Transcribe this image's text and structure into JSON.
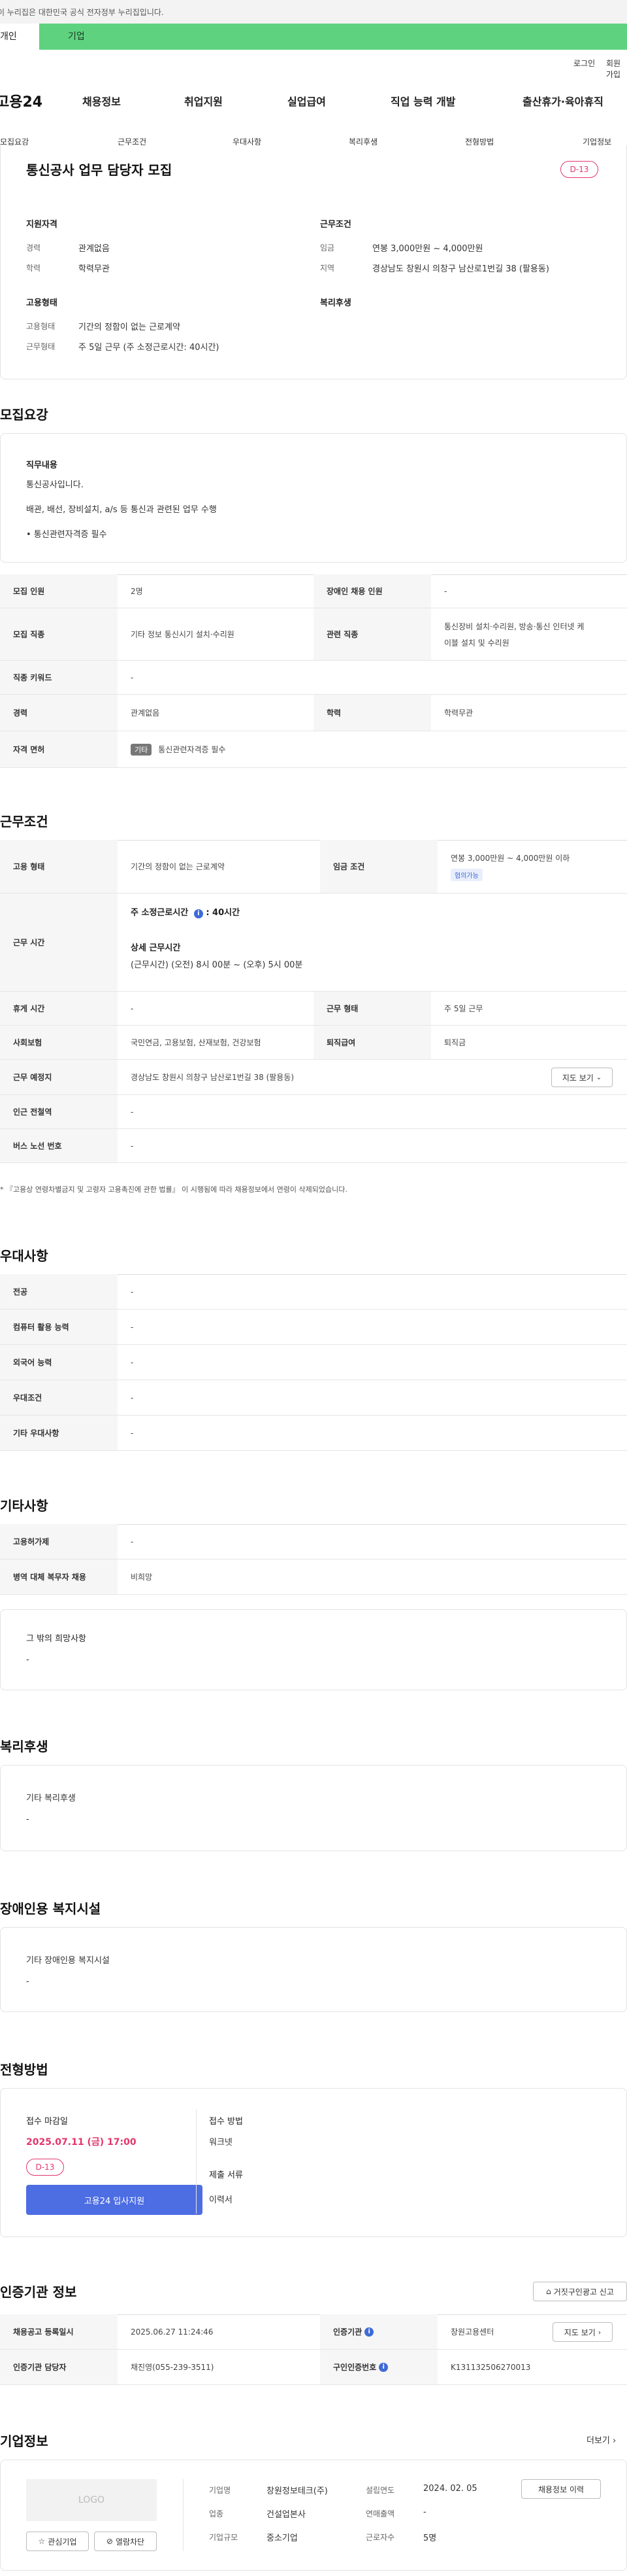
{
  "gov_banner": "이 누리집은 대한민국 공식 전자정부 누리집입니다.",
  "user_tabs": [
    "개인",
    "기업"
  ],
  "util": {
    "login": "로그인",
    "join": "회원가입"
  },
  "logo": "고용24",
  "gnb": [
    "채용정보",
    "취업지원",
    "실업급여",
    "직업 능력 개발",
    "출산휴가·육아휴직"
  ],
  "subnav": [
    "모집요강",
    "근무조건",
    "우대사항",
    "복리후생",
    "전형방법",
    "기업정보"
  ],
  "summary": {
    "title": "통신공사 업무 담당자 모집",
    "dday": "D-13",
    "qual_title": "지원자격",
    "career_lbl": "경력",
    "career_val": "관계없음",
    "edu_lbl": "학력",
    "edu_val": "학력무관",
    "emp_title": "고용형태",
    "emp_type_lbl": "고용형태",
    "emp_type_val": "기간의 정함이 없는 근로계약",
    "work_form_lbl": "근무형태",
    "work_form_val": "주 5일 근무 (주 소정근로시간: 40시간)",
    "cond_title": "근무조건",
    "wage_lbl": "임금",
    "wage_val": "연봉 3,000만원 ~ 4,000만원",
    "region_lbl": "지역",
    "region_val": "경상남도 창원시 의창구 남산로1번길 38 (팔용동)",
    "welfare_title": "복리후생"
  },
  "recruit": {
    "title": "모집요강",
    "duty_title": "직무내용",
    "duty_lines": [
      "통신공사입니다.",
      "배관, 배선, 장비설치, a/s 등 통신과 관련된 업무 수행",
      "• 통신관련자격증 필수"
    ],
    "rows": {
      "count_lbl": "모집 인원",
      "count_val": "2명",
      "disabled_lbl": "장애인 채용 인원",
      "disabled_val": "-",
      "job_lbl": "모집 직종",
      "job_val": "기타 정보 통신시기 설치·수리원",
      "rel_job_lbl": "관련 직종",
      "rel_job_val1": "통신장비 설치·수리원, 방송·통신 인터넷 케",
      "rel_job_val2": "이블 설치 및 수리원",
      "keyword_lbl": "직종 키워드",
      "keyword_val": "-",
      "career_lbl": "경력",
      "career_val": "관계없음",
      "edu_lbl": "학력",
      "edu_val": "학력무관",
      "license_lbl": "자격 면허",
      "license_badge": "기타",
      "license_val": "통신관련자격증 필수"
    }
  },
  "work": {
    "title": "근무조건",
    "emp_lbl": "고용 형태",
    "emp_val": "기간의 정함이 없는 근로계약",
    "wage_lbl": "임금 조건",
    "wage_val": "연봉 3,000만원 ~ 4,000만원 이하",
    "wage_badge": "협의가능",
    "hours_lbl": "근무 시간",
    "hours_std": "주 소정근로시간",
    "hours_std_val": ": 40시간",
    "hours_detail_title": "상세 근무시간",
    "hours_detail": "(근무시간) (오전) 8시 00분 ~ (오후) 5시 00분",
    "rest_lbl": "휴게 시간",
    "rest_val": "-",
    "form_lbl": "근무 형태",
    "form_val": "주 5일 근무",
    "insurance_lbl": "사회보험",
    "insurance_val": "국민연금, 고용보험, 산재보험, 건강보험",
    "retire_lbl": "퇴직급여",
    "retire_val": "퇴직금",
    "place_lbl": "근무 예정지",
    "place_val": "경상남도 창원시 의창구 남산로1번길 38 (팔용동)",
    "map_btn": "지도 보기",
    "subway_lbl": "인근 전철역",
    "subway_val": "-",
    "bus_lbl": "버스 노선 번호",
    "bus_val": "-",
    "note": "* 『고용상 연령차별금지 및 고령자 고용촉진에 관한 법률』 이 시행됨에 따라 채용정보에서 연령이 삭제되었습니다."
  },
  "pref": {
    "title": "우대사항",
    "rows": [
      {
        "lbl": "전공",
        "val": "-"
      },
      {
        "lbl": "컴퓨터 활용 능력",
        "val": "-"
      },
      {
        "lbl": "외국어 능력",
        "val": "-"
      },
      {
        "lbl": "우대조건",
        "val": "-"
      },
      {
        "lbl": "기타 우대사항",
        "val": "-"
      }
    ]
  },
  "etc": {
    "title": "기타사항",
    "employ_lbl": "고용허가제",
    "employ_val": "-",
    "military_lbl": "병역 대체 복무자 채용",
    "military_val": "비희망",
    "other_title": "그 밖의 희망사항",
    "other_val": "-"
  },
  "welfare": {
    "title": "복리후생",
    "sub": "기타 복리후생",
    "val": "-"
  },
  "disabled": {
    "title": "장애인용 복지시설",
    "sub": "기타 장애인용 복지시설",
    "val": "-"
  },
  "process": {
    "title": "전형방법",
    "deadline_lbl": "접수 마감일",
    "deadline_val": "2025.07.11 (금) 17:00",
    "dday": "D-13",
    "apply_btn": "고용24 입사지원",
    "method_lbl": "접수 방법",
    "method_val": "워크넷",
    "docs_lbl": "제출 서류",
    "docs_val": "이력서"
  },
  "cert": {
    "title": "인증기관 정보",
    "report_btn": "거짓구인광고 신고",
    "reg_lbl": "채용공고 등록일시",
    "reg_val": "2025.06.27 11:24:46",
    "agency_lbl": "인증기관",
    "agency_val": "창원고용센터",
    "map_btn": "지도 보기",
    "manager_lbl": "인증기관 담당자",
    "manager_val": "채진영(055-239-3511)",
    "num_lbl": "구인인증번호",
    "num_val": "K131132506270013"
  },
  "company": {
    "title": "기업정보",
    "more": "더보기",
    "logo_text": "LOGO",
    "fav_btn": "관심기업",
    "block_btn": "열람차단",
    "name_lbl": "기업명",
    "name_val": "창원정보테크(주)",
    "found_lbl": "설립연도",
    "found_val": "2024. 02. 05",
    "history_btn": "채용정보 이력",
    "biz_lbl": "업종",
    "biz_val": "건설업본사",
    "sales_lbl": "연매출액",
    "sales_val": "-",
    "size_lbl": "기업규모",
    "size_val": "중소기업",
    "emp_lbl": "근로자수",
    "emp_val": "5명"
  }
}
